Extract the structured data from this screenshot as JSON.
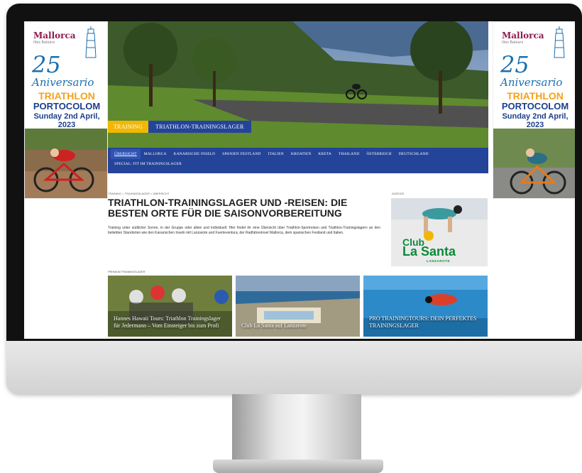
{
  "ads": {
    "side": {
      "brand": "Mallorca",
      "brand_sub": "Illes Balears",
      "number": "25",
      "anniversary": "Aniversario",
      "event": "TRIATHLON",
      "location": "PORTOCOLOM",
      "date": "Sunday 2nd April, 2023"
    },
    "sponsor_label": "ANZEIGE",
    "club": {
      "line1": "Club",
      "line2": "La Santa",
      "sub": "LANZAROTE"
    }
  },
  "hero": {
    "tag_training": "TRAINING",
    "tag_title": "TRIATHLON-TRAININGSLAGER"
  },
  "nav": {
    "items": [
      "ÜBERSICHT",
      "MALLORCA",
      "KANARISCHE INSELN",
      "SPANIEN FESTLAND",
      "ITALIEN",
      "KROATIEN",
      "KRETA",
      "THAILAND",
      "ÖSTERREICH",
      "DEUTSCHLAND",
      "SPECIAL: FIT IM TRAININGSLAGER"
    ]
  },
  "article": {
    "breadcrumb": "TRAINING > TRAININGSLAGER > ÜBERSICHT",
    "title": "TRIATHLON-TRAININGSLAGER UND -REISEN: DIE BESTEN ORTE FÜR DIE SAISONVORBEREITUNG",
    "intro": "Training unter südlicher Sonne, in der Gruppe oder allein und individuell. Hier findet ihr eine Übersicht über Triathlon-Sportreisen und Triathlon-Trainingslagern an den beliebten Standorten wie den Kanarischen Inseln mit Lanzarote und Fuerteventura, der Radfahrerinsel Mallorca, dem spanischen Festland und Italien."
  },
  "premium": {
    "label": "PREMIUM TRAININGSLAGER",
    "cards": [
      {
        "title": "Hannes Hawaii Tours: Triathlon Trainingslager für Jedermann – Vom Einsteiger bis zum Profi"
      },
      {
        "title": "Club La Santa auf Lanzarote"
      },
      {
        "title": "PRO TRAININGTOURS: DEIN PERFEKTES TRAININGSLAGER"
      }
    ]
  },
  "colors": {
    "nav_blue": "#24449a",
    "accent_yellow": "#f2b705",
    "ad_blue": "#1b6fae",
    "ad_orange": "#f3a31b",
    "club_green": "#0b8a3a"
  }
}
